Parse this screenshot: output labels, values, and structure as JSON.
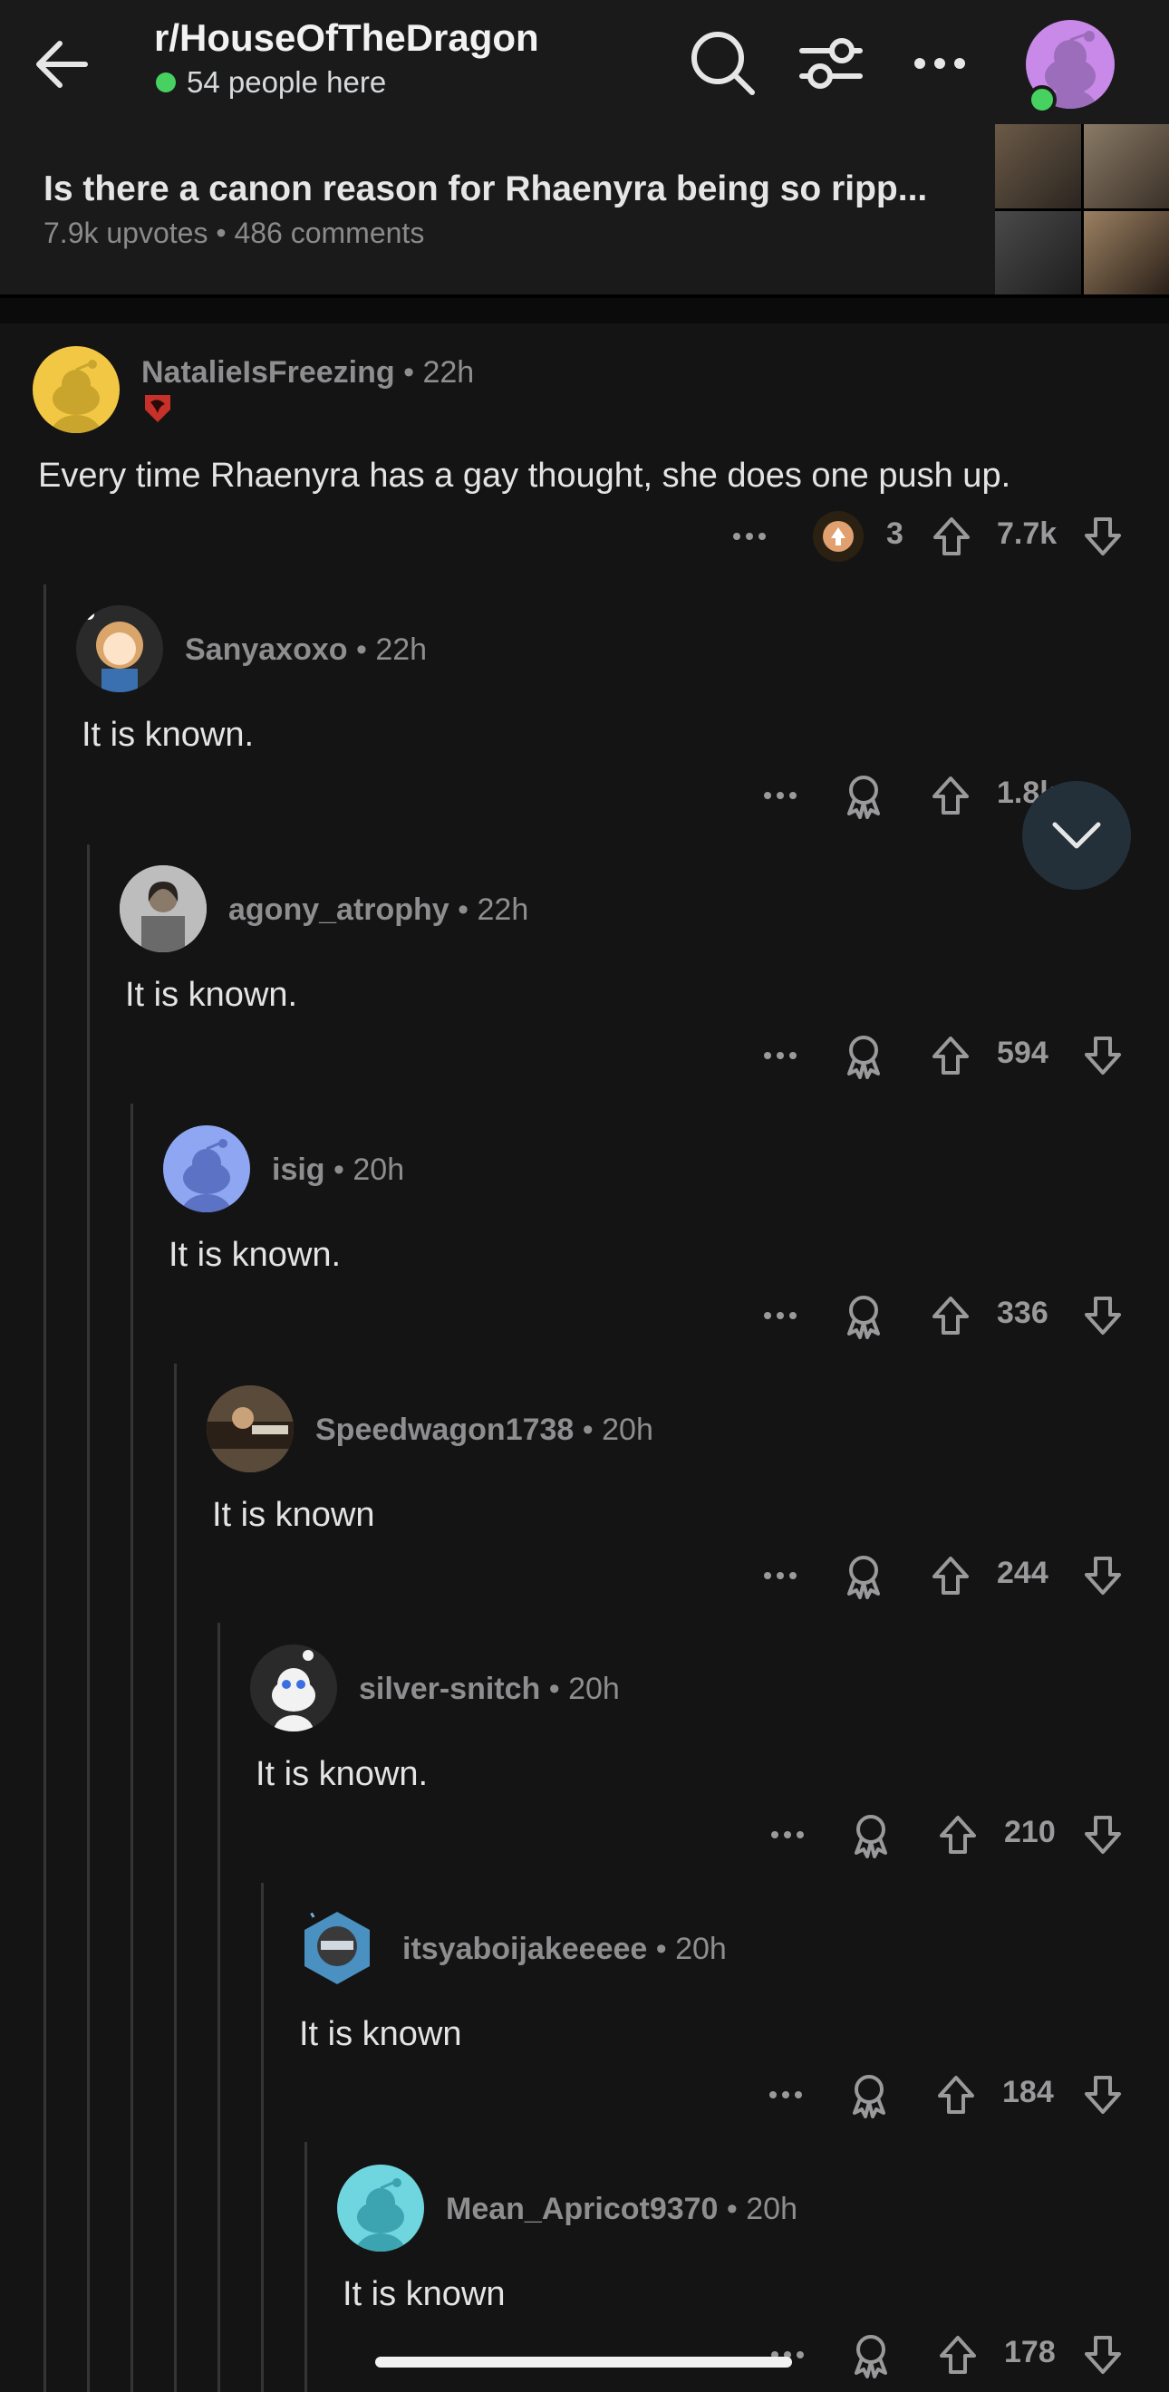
{
  "header": {
    "subreddit": "r/HouseOfTheDragon",
    "online_text": "54 people here",
    "icons": [
      "back-arrow-icon",
      "search-icon",
      "filter-icon",
      "more-icon",
      "profile-avatar"
    ]
  },
  "post": {
    "title": "Is there a canon reason for Rhaenyra being so ripp...",
    "meta": "7.9k upvotes • 486 comments"
  },
  "comments": [
    {
      "user": "NatalieIsFreezing",
      "time": "• 22h",
      "body": "Every time Rhaenyra has a gay thought, she does one push up.",
      "score": "7.7k",
      "awards": "3"
    },
    {
      "user": "Sanyaxoxo",
      "time": "• 22h",
      "body": "It is known.",
      "score": "1.8k"
    },
    {
      "user": "agony_atrophy",
      "time": "• 22h",
      "body": "It is known.",
      "score": "594"
    },
    {
      "user": "isig",
      "time": "• 20h",
      "body": "It is known.",
      "score": "336"
    },
    {
      "user": "Speedwagon1738",
      "time": "• 20h",
      "body": "It is known",
      "score": "244"
    },
    {
      "user": "silver-snitch",
      "time": "• 20h",
      "body": "It is known.",
      "score": "210"
    },
    {
      "user": "itsyaboijakeeeee",
      "time": "• 20h",
      "body": "It is known",
      "score": "184"
    },
    {
      "user": "Mean_Apricot9370",
      "time": "• 20h",
      "body": "It is known",
      "score": "178"
    }
  ],
  "colors": {
    "background": "#141414",
    "online": "#46d160",
    "accent": "#23303a"
  }
}
